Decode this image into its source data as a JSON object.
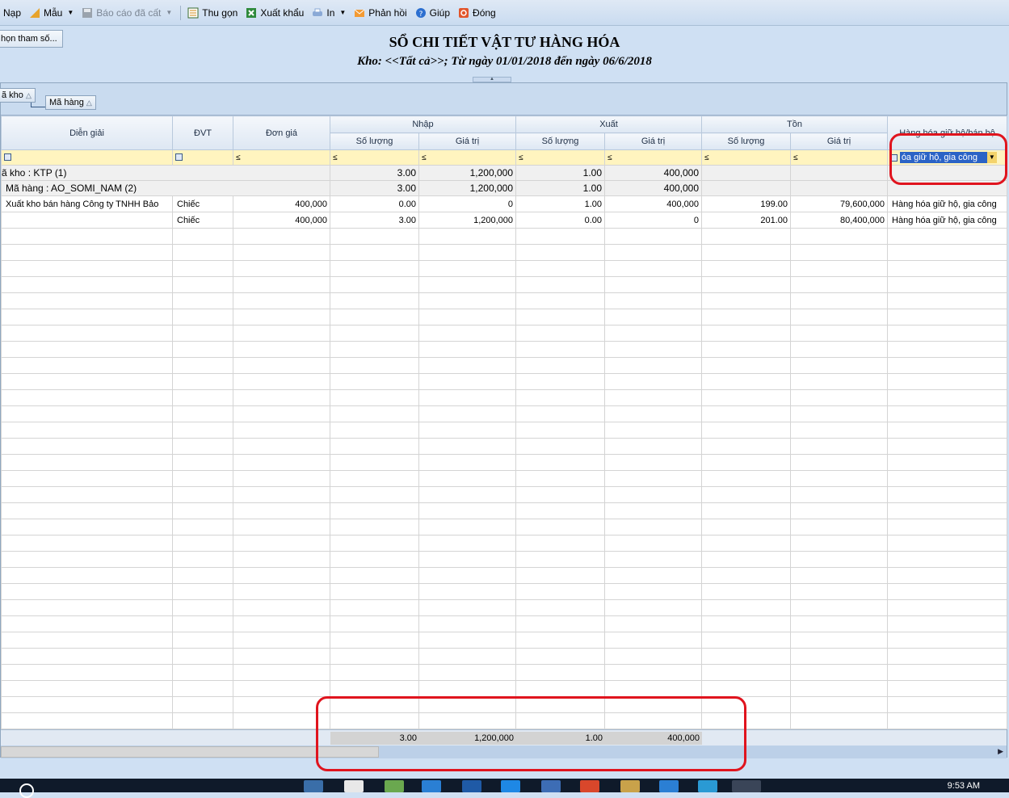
{
  "toolbar": {
    "items": [
      {
        "label": "Nạp",
        "icon": "refresh-icon"
      },
      {
        "label": "Mẫu",
        "icon": "template-icon"
      },
      {
        "label": "Báo cáo đã cất",
        "icon": "save-icon"
      },
      {
        "label": "Thu gọn",
        "icon": "collapse-icon"
      },
      {
        "label": "Xuất khẩu",
        "icon": "excel-icon"
      },
      {
        "label": "In",
        "icon": "print-icon"
      },
      {
        "label": "Phản hồi",
        "icon": "mail-icon"
      },
      {
        "label": "Giúp",
        "icon": "help-icon"
      },
      {
        "label": "Đóng",
        "icon": "close-icon"
      }
    ]
  },
  "params_button": "họn tham số...",
  "report": {
    "title": "SỔ CHI TIẾT VẬT TƯ HÀNG HÓA",
    "subtitle": "Kho: <<Tất cả>>; Từ ngày 01/01/2018 đến ngày 06/6/2018"
  },
  "group_panel": {
    "chip1": "ã kho",
    "chip2": "Mã hàng"
  },
  "columns": {
    "dien_giai": "Diễn giải",
    "dvt": "ĐVT",
    "don_gia": "Đơn giá",
    "nhap": "Nhập",
    "xuat": "Xuất",
    "ton": "Tồn",
    "hang_hoa": "Hàng hóa giữ hộ/bán hộ",
    "so_luong": "Số lượng",
    "gia_tri": "Giá trị"
  },
  "filter": {
    "le": "≤",
    "combo_value": "óa giữ hộ, gia công"
  },
  "groups": {
    "kho_label": "ã kho : KTP (1)",
    "kho_nhap_sl": "3.00",
    "kho_nhap_gt": "1,200,000",
    "kho_xuat_sl": "1.00",
    "kho_xuat_gt": "400,000",
    "hang_label": "Mã hàng : AO_SOMI_NAM (2)",
    "hang_nhap_sl": "3.00",
    "hang_nhap_gt": "1,200,000",
    "hang_xuat_sl": "1.00",
    "hang_xuat_gt": "400,000"
  },
  "rows": [
    {
      "dien_giai": "Xuất kho bán hàng Công ty TNHH Bảo",
      "dvt": "Chiếc",
      "don_gia": "400,000",
      "nhap_sl": "0.00",
      "nhap_gt": "0",
      "xuat_sl": "1.00",
      "xuat_gt": "400,000",
      "ton_sl": "199.00",
      "ton_gt": "79,600,000",
      "hang_hoa": "Hàng hóa giữ hộ, gia công"
    },
    {
      "dien_giai": "",
      "dvt": "Chiếc",
      "don_gia": "400,000",
      "nhap_sl": "3.00",
      "nhap_gt": "1,200,000",
      "xuat_sl": "0.00",
      "xuat_gt": "0",
      "ton_sl": "201.00",
      "ton_gt": "80,400,000",
      "hang_hoa": "Hàng hóa giữ hộ, gia công"
    }
  ],
  "totals": {
    "nhap_sl": "3.00",
    "nhap_gt": "1,200,000",
    "xuat_sl": "1.00",
    "xuat_gt": "400,000"
  },
  "taskbar": {
    "clock": "9:53 AM"
  },
  "colors": {
    "highlight": "#e0141e",
    "filter_row": "#fff4bf",
    "header": "#dde7f3"
  }
}
